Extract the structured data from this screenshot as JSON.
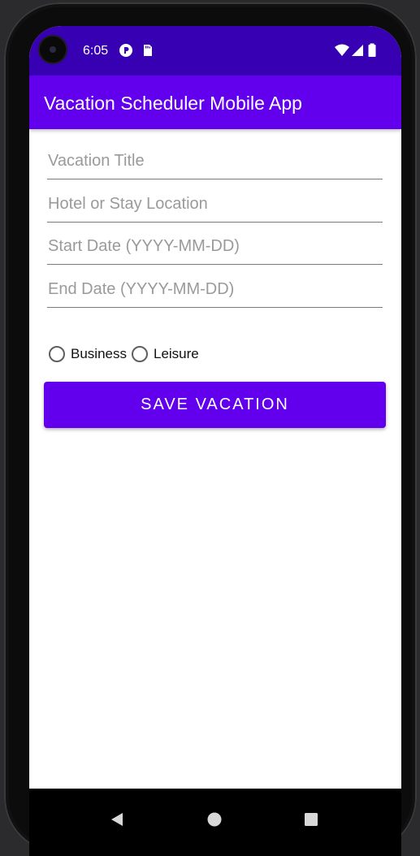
{
  "status_bar": {
    "time": "6:05",
    "icons": [
      "camera-cutout",
      "notification-icon",
      "sd-card-icon",
      "wifi-icon",
      "signal-icon",
      "battery-icon"
    ]
  },
  "app_bar": {
    "title": "Vacation Scheduler Mobile App"
  },
  "form": {
    "title_field": {
      "value": "",
      "placeholder": "Vacation Title"
    },
    "location_field": {
      "value": "",
      "placeholder": "Hotel or Stay Location"
    },
    "start_date_field": {
      "value": "",
      "placeholder": "Start Date (YYYY-MM-DD)"
    },
    "end_date_field": {
      "value": "",
      "placeholder": "End Date (YYYY-MM-DD)"
    },
    "type_options": [
      {
        "label": "Business",
        "selected": false
      },
      {
        "label": "Leisure",
        "selected": false
      }
    ],
    "save_label": "SAVE VACATION"
  },
  "nav_bar": {
    "icons": [
      "back-icon",
      "home-icon",
      "recents-icon"
    ]
  },
  "colors": {
    "status_bar": "#3700b3",
    "primary": "#6200ee",
    "background": "#ffffff"
  }
}
